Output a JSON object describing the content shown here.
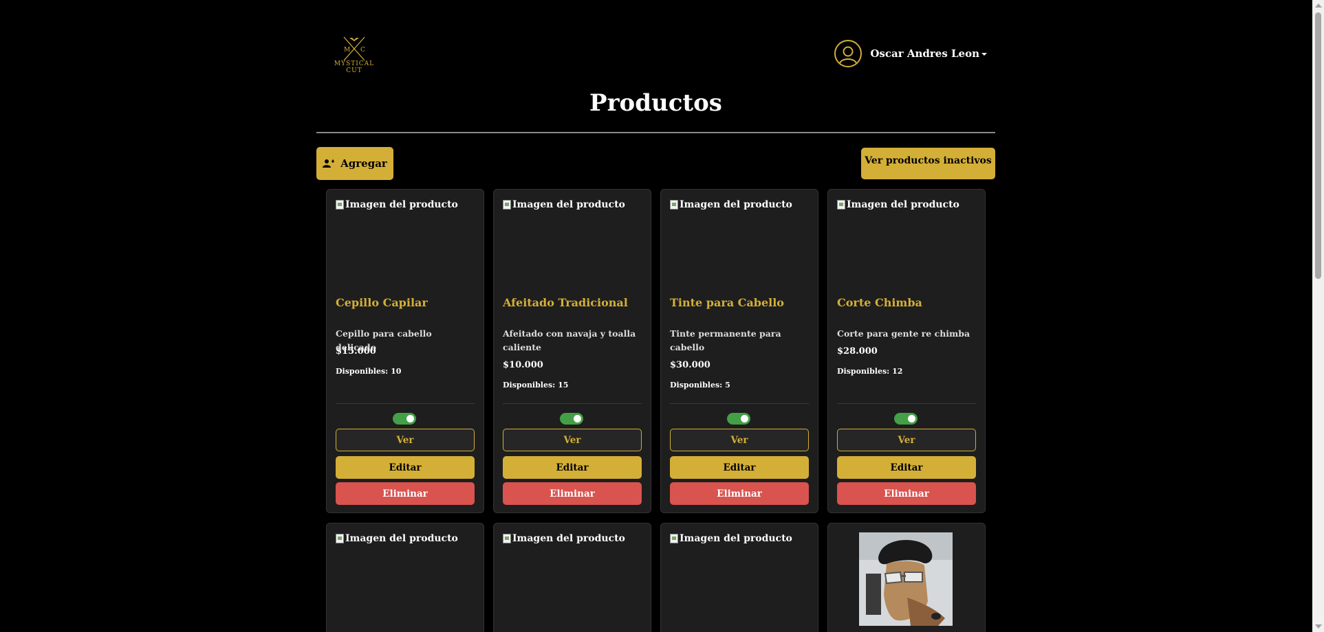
{
  "brand": {
    "line1": "MYSTICAL",
    "line2": "CUT",
    "monogram_left": "M",
    "monogram_right": "C"
  },
  "user": {
    "name": "Oscar Andres Leon"
  },
  "page_title": "Productos",
  "actions": {
    "add_label": "Agregar",
    "inactive_label": "Ver productos inactivos"
  },
  "image_alt": "Imagen del producto",
  "card_buttons": {
    "view": "Ver",
    "edit": "Editar",
    "delete": "Eliminar"
  },
  "products": [
    {
      "name": "Cepillo Capilar",
      "description": "Cepillo para cabello delicado",
      "price": "$15.000",
      "stock": "Disponibles: 10",
      "active": true
    },
    {
      "name": "Afeitado Tradicional",
      "description": "Afeitado con navaja y toalla caliente",
      "price": "$10.000",
      "stock": "Disponibles: 15",
      "active": true
    },
    {
      "name": "Tinte para Cabello",
      "description": "Tinte permanente para cabello",
      "price": "$30.000",
      "stock": "Disponibles: 5",
      "active": true
    },
    {
      "name": "Corte Chimba",
      "description": "Corte para gente re chimba",
      "price": "$28.000",
      "stock": "Disponibles: 12",
      "active": true
    }
  ],
  "colors": {
    "accent": "#d4af37",
    "danger": "#d9534f",
    "toggle_on": "#43a047",
    "card_bg": "#1e1e1e",
    "page_bg": "#000000"
  }
}
